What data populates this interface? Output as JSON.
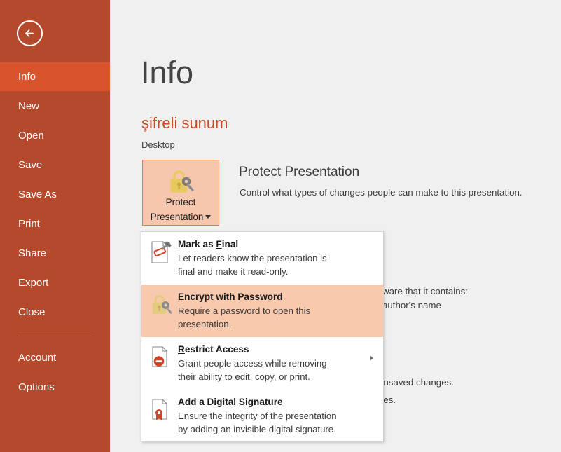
{
  "app": {
    "backstage_title": "Info",
    "accent_color": "#b4492c",
    "selected_color": "#d9532c",
    "highlight_color": "#f8c9ac",
    "doc_title_color": "#c24a27"
  },
  "sidebar": {
    "back_icon": "back-arrow-icon",
    "items": [
      {
        "label": "Info",
        "selected": true
      },
      {
        "label": "New",
        "selected": false
      },
      {
        "label": "Open",
        "selected": false
      },
      {
        "label": "Save",
        "selected": false
      },
      {
        "label": "Save As",
        "selected": false
      },
      {
        "label": "Print",
        "selected": false
      },
      {
        "label": "Share",
        "selected": false
      },
      {
        "label": "Export",
        "selected": false
      },
      {
        "label": "Close",
        "selected": false
      },
      {
        "label": "Account",
        "selected": false
      },
      {
        "label": "Options",
        "selected": false
      }
    ]
  },
  "document": {
    "name": "şifreli sunum",
    "location": "Desktop"
  },
  "protect": {
    "button_line1": "Protect",
    "button_line2": "Presentation",
    "button_icon": "lock-key-icon",
    "caret_icon": "chevron-down-icon",
    "heading": "Protect Presentation",
    "description": "Control what types of changes people can make to this presentation."
  },
  "inspect": {
    "desc_line1": "ware that it contains:",
    "desc_line2": "author's name"
  },
  "manage": {
    "desc_line1": " unsaved changes.",
    "desc_line2": "ges."
  },
  "menu": {
    "items": [
      {
        "icon": "mark-as-final-icon",
        "title_pre": "Mark as ",
        "title_key": "F",
        "title_post": "inal",
        "desc_line1": "Let readers know the presentation is",
        "desc_line2": "final and make it read-only.",
        "highlighted": false,
        "has_submenu": false
      },
      {
        "icon": "encrypt-password-icon",
        "title_pre": "",
        "title_key": "E",
        "title_post": "ncrypt with Password",
        "desc_line1": "Require a password to open this",
        "desc_line2": "presentation.",
        "highlighted": true,
        "has_submenu": false
      },
      {
        "icon": "restrict-access-icon",
        "title_pre": "",
        "title_key": "R",
        "title_post": "estrict Access",
        "desc_line1": "Grant people access while removing",
        "desc_line2": "their ability to edit, copy, or print.",
        "highlighted": false,
        "has_submenu": true
      },
      {
        "icon": "digital-signature-icon",
        "title_pre": "Add a Digital ",
        "title_key": "S",
        "title_post": "ignature",
        "desc_line1": "Ensure the integrity of the presentation",
        "desc_line2": "by adding an invisible digital signature.",
        "highlighted": false,
        "has_submenu": false
      }
    ]
  }
}
